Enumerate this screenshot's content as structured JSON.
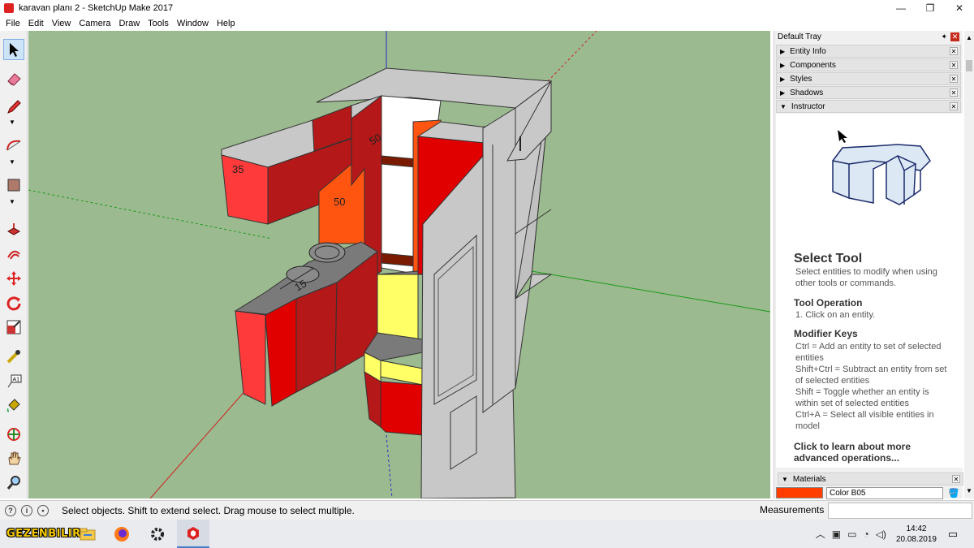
{
  "window": {
    "title": "karavan planı 2 - SketchUp Make 2017",
    "minimize": "—",
    "maximize": "❐",
    "close": "✕"
  },
  "menu": [
    "File",
    "Edit",
    "View",
    "Camera",
    "Draw",
    "Tools",
    "Window",
    "Help"
  ],
  "tools": [
    {
      "name": "select-tool",
      "icon": "arrow-cursor-icon",
      "active": true
    },
    {
      "name": "eraser-tool",
      "icon": "eraser-icon"
    },
    {
      "name": "pencil-tool",
      "icon": "pencil-icon"
    },
    {
      "name": "arc-tool",
      "icon": "arc-icon"
    },
    {
      "name": "rectangle-tool",
      "icon": "rectangle-icon"
    },
    {
      "name": "push-pull-tool",
      "icon": "push-pull-icon"
    },
    {
      "name": "offset-tool",
      "icon": "offset-icon"
    },
    {
      "name": "move-tool",
      "icon": "move-icon"
    },
    {
      "name": "rotate-tool",
      "icon": "rotate-icon"
    },
    {
      "name": "scale-tool",
      "icon": "scale-icon"
    },
    {
      "name": "tape-measure-tool",
      "icon": "tape-measure-icon"
    },
    {
      "name": "text-tool",
      "icon": "text-icon"
    },
    {
      "name": "paint-bucket-tool",
      "icon": "paint-bucket-icon"
    },
    {
      "name": "orbit-tool",
      "icon": "orbit-icon"
    },
    {
      "name": "pan-tool",
      "icon": "hand-icon"
    },
    {
      "name": "zoom-tool",
      "icon": "magnifier-icon"
    }
  ],
  "viewport": {
    "dimensions": [
      "35",
      "50",
      "50",
      "15"
    ]
  },
  "tray": {
    "title": "Default Tray",
    "panels": [
      {
        "label": "Entity Info",
        "expanded": false
      },
      {
        "label": "Components",
        "expanded": false
      },
      {
        "label": "Styles",
        "expanded": false
      },
      {
        "label": "Shadows",
        "expanded": false
      },
      {
        "label": "Instructor",
        "expanded": true
      }
    ],
    "instructor": {
      "heading": "Select Tool",
      "description": "Select entities to modify when using other tools or commands.",
      "op_heading": "Tool Operation",
      "op_text": "1. Click on an entity.",
      "mod_heading": "Modifier Keys",
      "mod_lines": [
        "Ctrl = Add an entity to set of selected entities",
        "Shift+Ctrl = Subtract an entity from set of selected entities",
        "Shift = Toggle whether an entity is within set of selected entities",
        "Ctrl+A = Select all visible entities in model"
      ],
      "learn_more": "Click to learn about more advanced operations..."
    },
    "materials": {
      "label": "Materials",
      "color_name": "Color B05",
      "swatch_color": "#ff3d00"
    }
  },
  "status": {
    "message": "Select objects. Shift to extend select. Drag mouse to select multiple.",
    "measurements_label": "Measurements",
    "measurements_value": ""
  },
  "taskbar": {
    "logo": "GEZENBILIR",
    "apps": [
      "file-explorer-icon",
      "firefox-icon",
      "settings-icon",
      "sketchup-icon"
    ],
    "time": "14:42",
    "date": "20.08.2019"
  }
}
